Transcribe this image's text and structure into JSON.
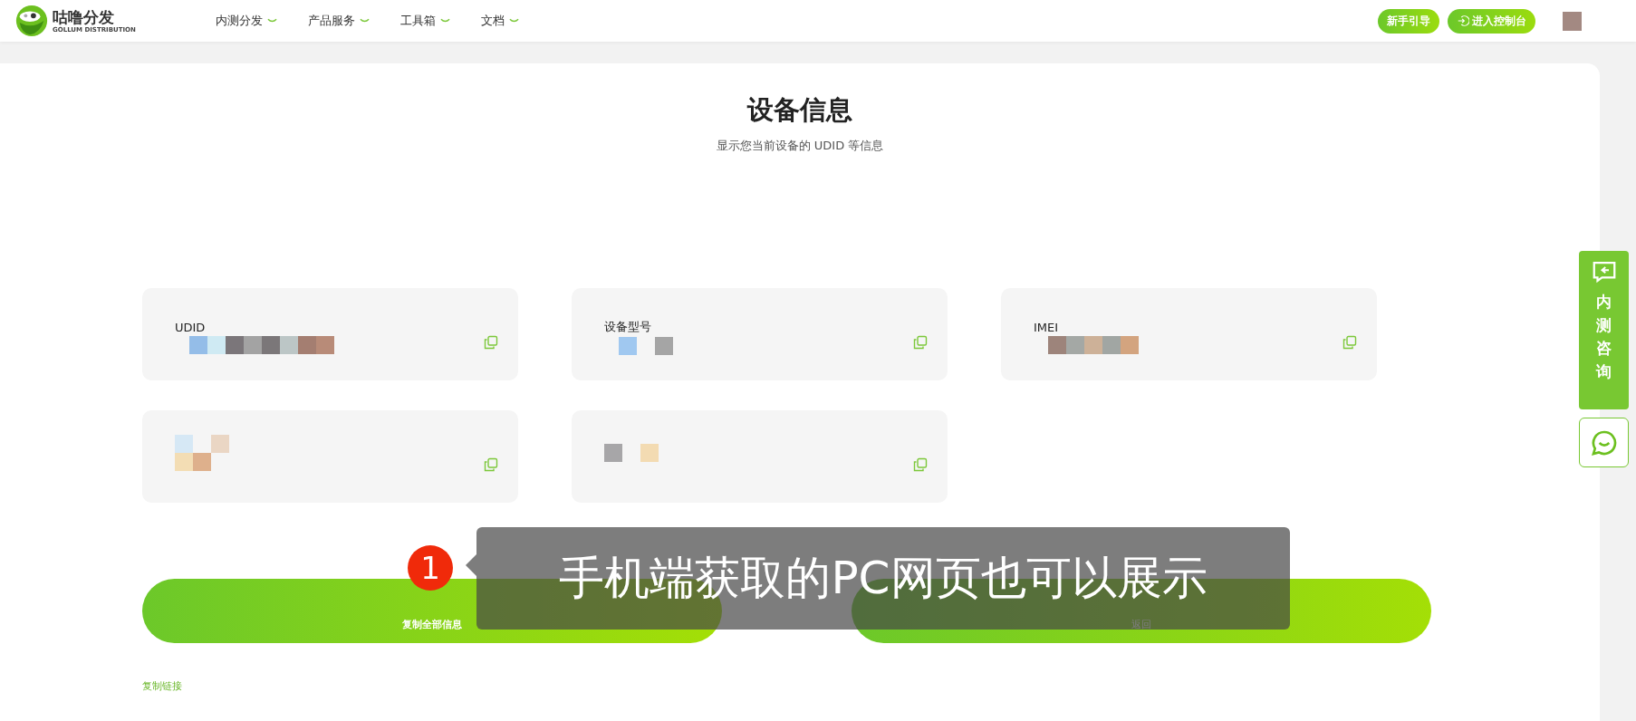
{
  "header": {
    "brand": {
      "name": "咕噜分发",
      "subtitle": "GOLLUM DISTRIBUTION"
    },
    "nav": [
      {
        "label": "内测分发",
        "expanded": false
      },
      {
        "label": "产品服务",
        "expanded": false
      },
      {
        "label": "工具箱",
        "expanded": false
      },
      {
        "label": "文档",
        "expanded": false
      }
    ],
    "actions": [
      {
        "label": "新手引导",
        "kind": "plain"
      },
      {
        "label": "进入控制台",
        "kind": "enter"
      }
    ]
  },
  "page": {
    "title": "设备信息",
    "subtitle": "显示您当前设备的 UDID 等信息"
  },
  "cards": [
    {
      "label": "UDID",
      "redacted": true
    },
    {
      "label": "设备型号",
      "redacted": true
    },
    {
      "label": "IMEI",
      "redacted": true
    },
    {
      "redacted": true
    },
    {
      "redacted": true
    }
  ],
  "buttons": [
    {
      "label": "复制全部信息",
      "kind": "primary"
    },
    {
      "label": "返回",
      "kind": "secondary"
    }
  ],
  "link": "复制链接",
  "side": {
    "consult": "内测咨询"
  },
  "callout": {
    "badge": "1",
    "text": "手机端获取的PC网页也可以展示"
  }
}
